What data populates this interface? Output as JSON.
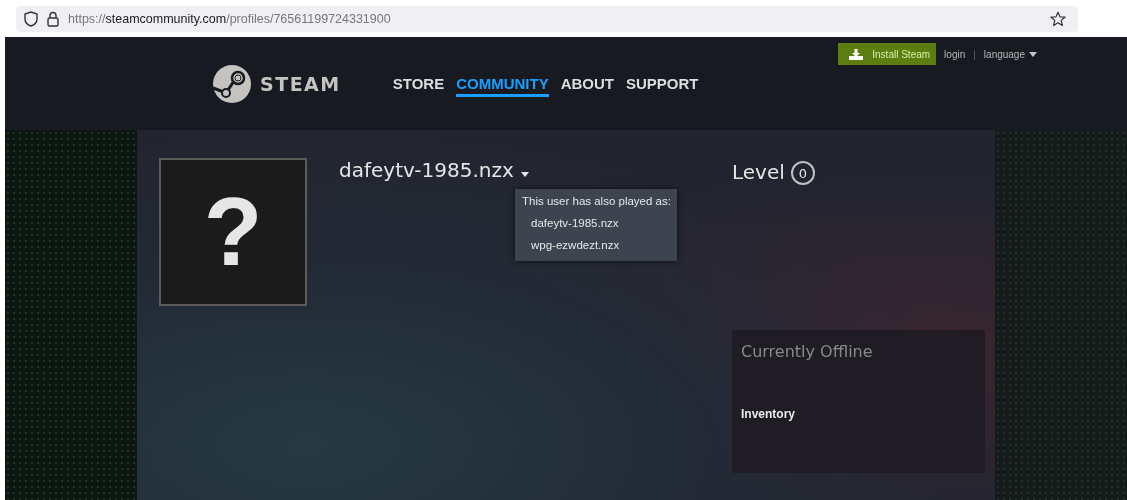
{
  "browser": {
    "url": {
      "scheme": "https://",
      "host": "steamcommunity.com",
      "path": "/profiles/76561199724331900"
    }
  },
  "header": {
    "logo_text": "STEAM",
    "nav": [
      {
        "label": "STORE",
        "selected": false
      },
      {
        "label": "COMMUNITY",
        "selected": true
      },
      {
        "label": "ABOUT",
        "selected": false
      },
      {
        "label": "SUPPORT",
        "selected": false
      }
    ],
    "install_button": "Install Steam",
    "login": "login",
    "separator": "|",
    "language": "language"
  },
  "profile": {
    "avatar_glyph": "?",
    "name": "dafeytv-1985.nzx",
    "level_label": "Level",
    "level": "0",
    "aliases_popup": {
      "title": "This user has also played as:",
      "aliases": [
        "dafeytv-1985.nzx",
        "wpg-ezwdezt.nzx"
      ]
    },
    "status": "Currently Offline",
    "links": [
      "Inventory"
    ]
  }
}
